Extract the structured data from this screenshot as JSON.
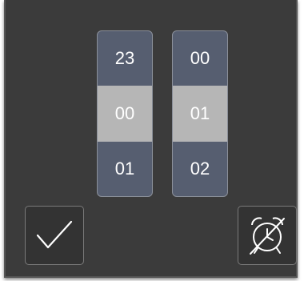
{
  "time_picker": {
    "hours": {
      "prev": "23",
      "selected": "00",
      "next": "01"
    },
    "minutes": {
      "prev": "00",
      "selected": "01",
      "next": "02"
    }
  },
  "buttons": {
    "confirm_icon": "checkmark-icon",
    "alarm_off_icon": "alarm-clock-off-icon"
  },
  "colors": {
    "dialog_bg": "#3b3b3b",
    "drum_bg": "#565e70",
    "selected_bg": "#b6b6b6",
    "text": "#ffffff"
  }
}
